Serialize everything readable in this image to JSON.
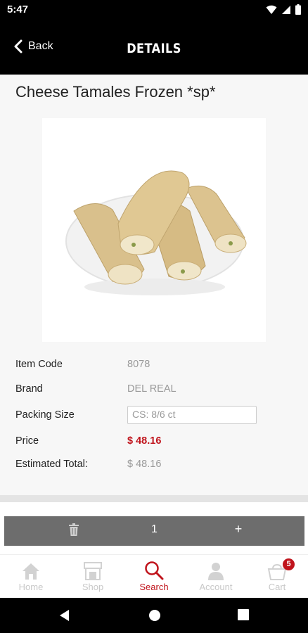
{
  "status_bar": {
    "time": "5:47"
  },
  "header": {
    "back_label": "Back",
    "title": "DETAILS"
  },
  "product": {
    "title": "Cheese Tamales Frozen *sp*",
    "image_alt": "tamales-photo"
  },
  "details": {
    "item_code_label": "Item Code",
    "item_code": "8078",
    "brand_label": "Brand",
    "brand": "DEL REAL",
    "packing_label": "Packing Size",
    "packing_value": "CS: 8/6 ct",
    "price_label": "Price",
    "price": "$ 48.16",
    "total_label": "Estimated Total:",
    "total": "$ 48.16"
  },
  "quantity": {
    "value": "1",
    "plus": "+"
  },
  "nav": {
    "items": [
      {
        "label": "Home",
        "icon": "home-icon"
      },
      {
        "label": "Shop",
        "icon": "shop-icon"
      },
      {
        "label": "Search",
        "icon": "search-icon"
      },
      {
        "label": "Account",
        "icon": "account-icon"
      },
      {
        "label": "Cart",
        "icon": "cart-icon"
      }
    ],
    "active": "Search",
    "cart_count": "5"
  },
  "colors": {
    "accent": "#c0141c",
    "header_bg": "#000000",
    "qty_bar": "#6d6d6d"
  }
}
